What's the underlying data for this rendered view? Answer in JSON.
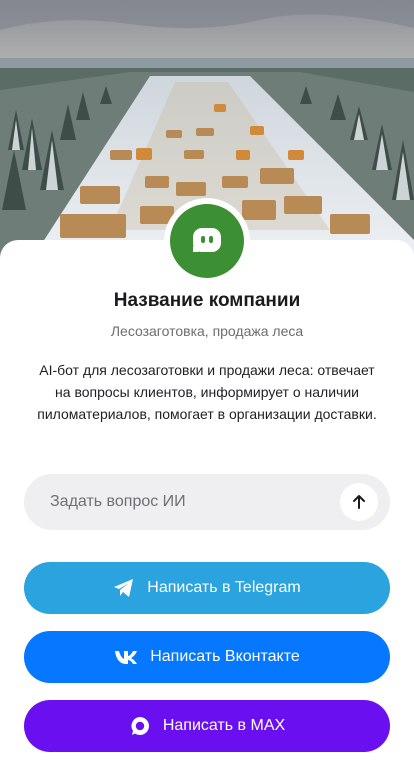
{
  "company": {
    "name": "Название компании",
    "tagline": "Лесозаготовка, продажа леса",
    "description": "AI-бот для лесозаготовки и продажи леса: отвечает на вопросы клиентов, информирует о наличии пиломатериалов, помогает в организации доставки."
  },
  "hero": {
    "icon": "forest-logging-photo"
  },
  "avatar": {
    "icon": "chat-bot-icon",
    "color": "#3c8f32"
  },
  "ask": {
    "placeholder": "Задать вопрос ИИ",
    "send_icon": "arrow-up-icon"
  },
  "buttons": [
    {
      "label": "Написать в Telegram",
      "icon": "telegram-icon",
      "color": "#2aa3df"
    },
    {
      "label": "Написать Вконтакте",
      "icon": "vk-icon",
      "color": "#0677ff"
    },
    {
      "label": "Написать в MAX",
      "icon": "max-icon",
      "color": "#6a10f0"
    }
  ]
}
